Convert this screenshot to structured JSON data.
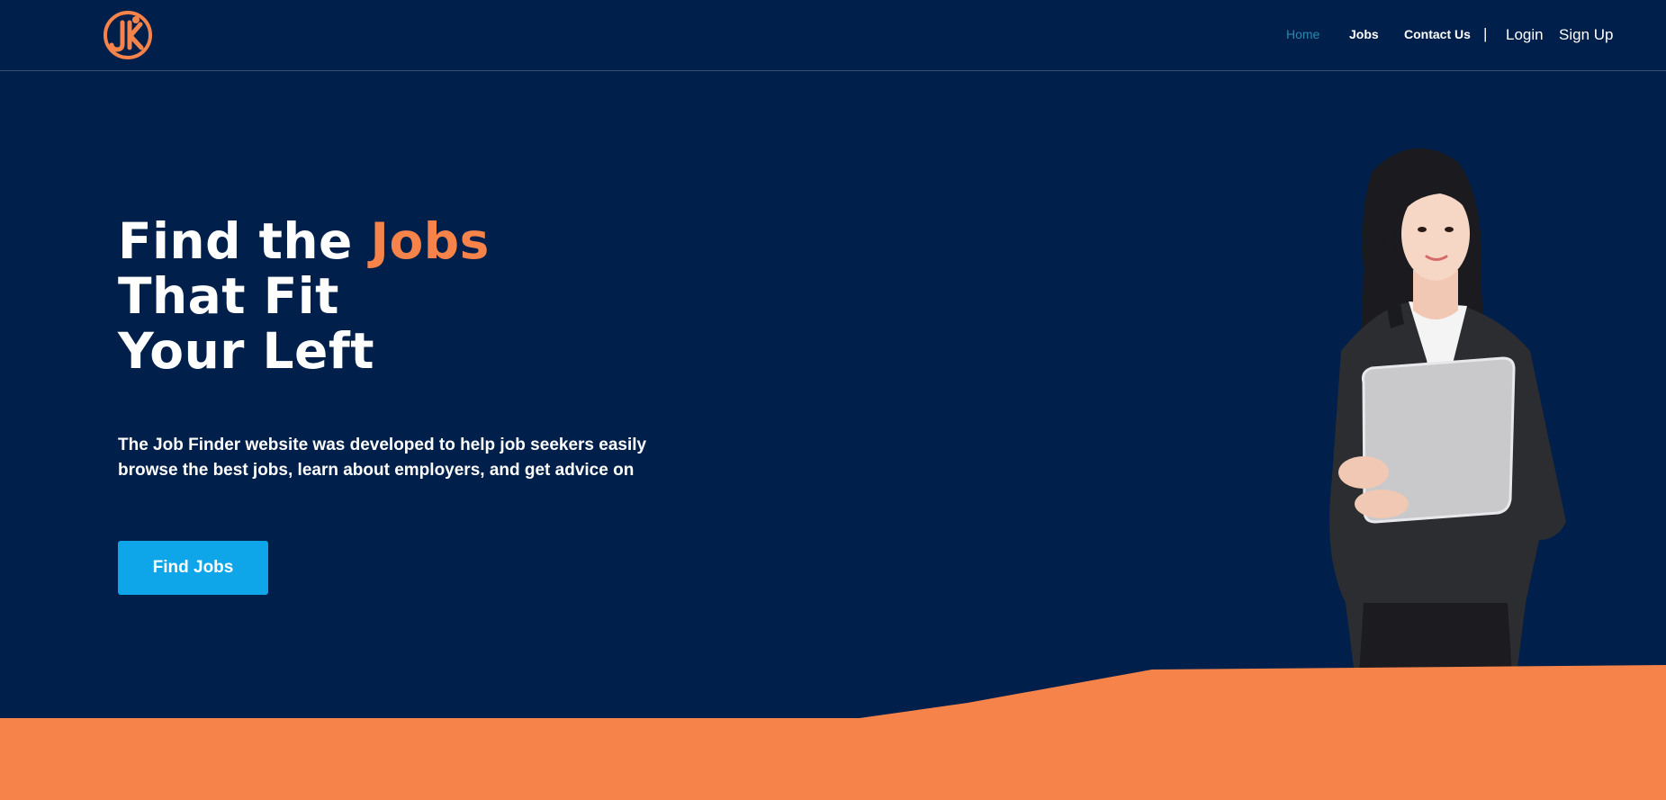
{
  "nav": {
    "home": "Home",
    "jobs": "Jobs",
    "contact": "Contact Us",
    "separator": "|",
    "login": "Login",
    "signup": "Sign Up"
  },
  "hero": {
    "title_line1_prefix": "Find the ",
    "title_line1_accent": "Jobs",
    "title_line2": "That Fit",
    "title_line3": "Your Left",
    "description": "The Job Finder website was developed to help job seekers easily browse the best jobs, learn about employers, and get advice on",
    "cta_label": "Find Jobs"
  },
  "colors": {
    "background": "#00204b",
    "accent": "#f6844a",
    "nav_active": "#2e86ad",
    "button": "#0ea5e9"
  },
  "icons": {
    "logo": "job-finder-logo-icon"
  }
}
